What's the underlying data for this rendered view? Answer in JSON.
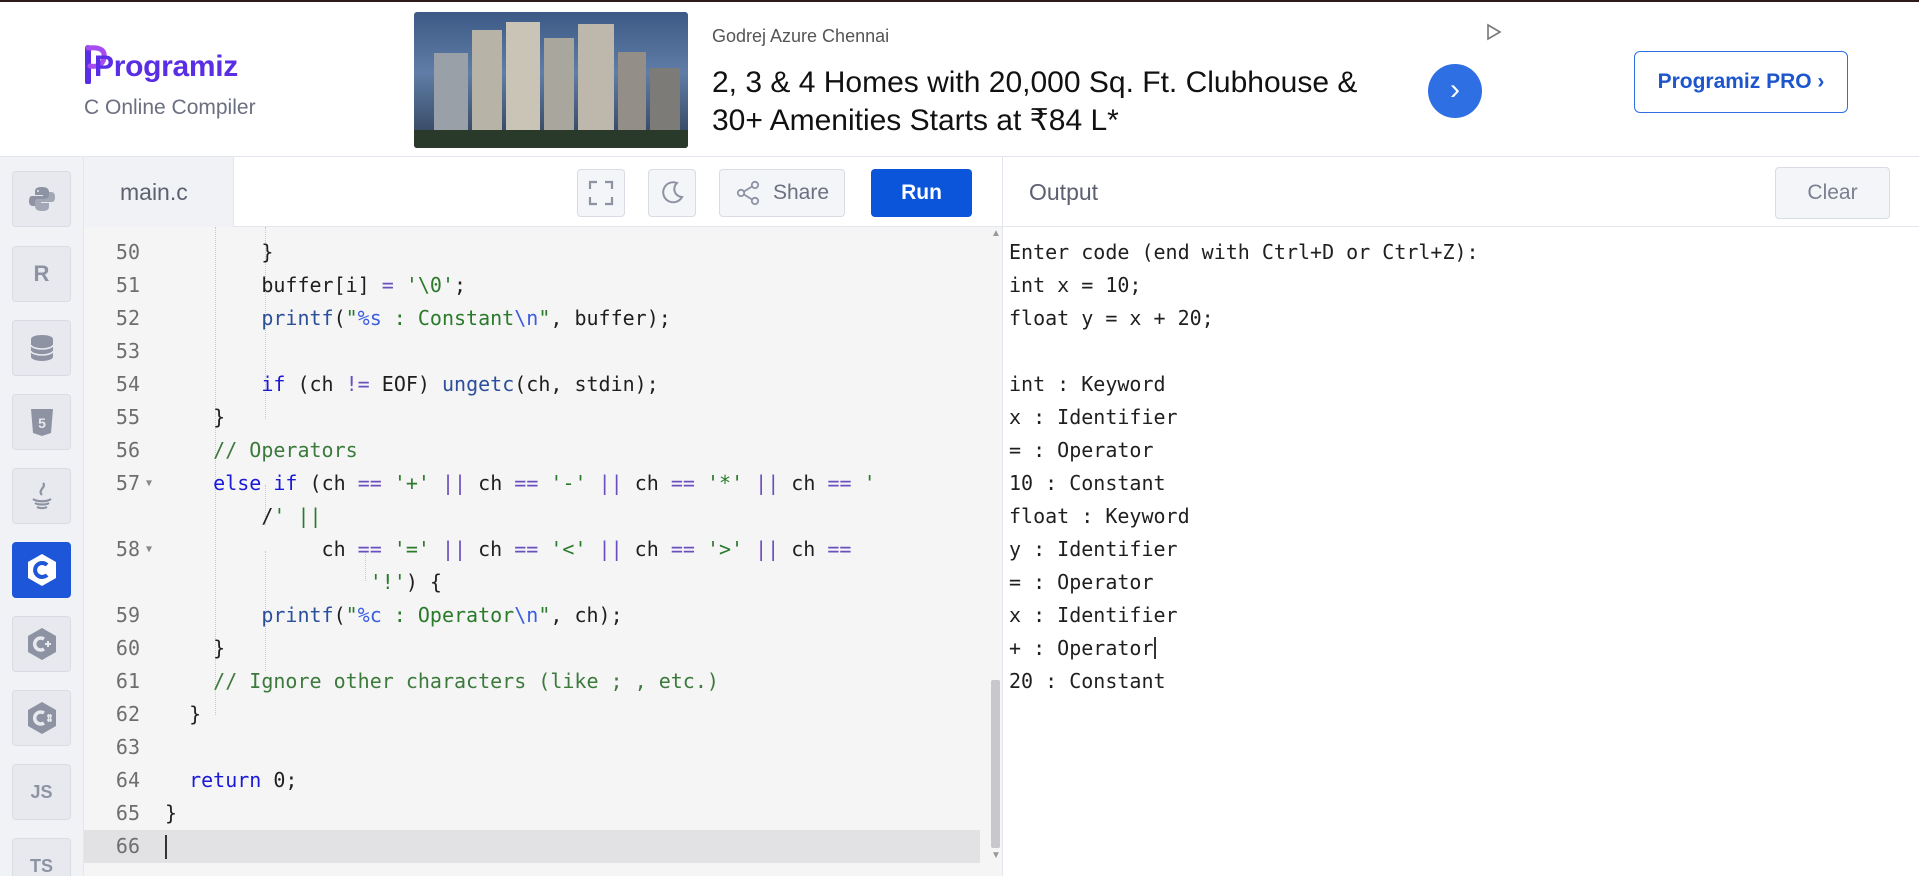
{
  "header": {
    "logo": "Programiz",
    "subtitle": "C Online Compiler",
    "pro_button": "Programiz PRO ›"
  },
  "ad": {
    "advertiser": "Godrej Azure Chennai",
    "headline": "2, 3 & 4 Homes with 20,000 Sq. Ft. Clubhouse & 30+ Amenities Starts at ₹84 L*",
    "arrow": "›"
  },
  "rail": {
    "items": [
      {
        "name": "python",
        "label": ""
      },
      {
        "name": "r",
        "label": "R"
      },
      {
        "name": "sql",
        "label": ""
      },
      {
        "name": "html",
        "label": "5"
      },
      {
        "name": "java",
        "label": ""
      },
      {
        "name": "c",
        "label": "C"
      },
      {
        "name": "cpp",
        "label": "C+"
      },
      {
        "name": "csharp",
        "label": "C#"
      },
      {
        "name": "javascript",
        "label": "JS"
      },
      {
        "name": "typescript",
        "label": "TS"
      }
    ],
    "active": "c"
  },
  "toolbar": {
    "file_name": "main.c",
    "share_label": "Share",
    "run_label": "Run"
  },
  "editor": {
    "line_numbers": [
      "50",
      "51",
      "52",
      "53",
      "54",
      "55",
      "56",
      "57",
      "",
      "58",
      "",
      "59",
      "60",
      "61",
      "62",
      "63",
      "64",
      "65",
      "66"
    ],
    "lines": [
      "        }",
      "        buffer[i] = '\\0';",
      "        printf(\"%s : Constant\\n\", buffer);",
      "",
      "        if (ch != EOF) ungetc(ch, stdin);",
      "    }",
      "    // Operators",
      "    else if (ch == '+' || ch == '-' || ch == '*' || ch == '",
      "        /' ||",
      "             ch == '=' || ch == '<' || ch == '>' || ch ==",
      "                 '!') {",
      "        printf(\"%c : Operator\\n\", ch);",
      "    }",
      "    // Ignore other characters (like ; , etc.)",
      "  }",
      "",
      "  return 0;",
      "}",
      ""
    ]
  },
  "output": {
    "title": "Output",
    "clear_label": "Clear",
    "lines": [
      "Enter code (end with Ctrl+D or Ctrl+Z):",
      "int x = 10;",
      "float y = x + 20;",
      "",
      "int : Keyword",
      "x : Identifier",
      "= : Operator",
      "10 : Constant",
      "float : Keyword",
      "y : Identifier",
      "= : Operator",
      "x : Identifier",
      "+ : Operator",
      "20 : Constant"
    ]
  },
  "colors": {
    "brand": "#5a2ee4",
    "accent": "#0a55d9",
    "keyword": "#1a1ad6",
    "string": "#2a7a2a",
    "comment": "#3c7a3c"
  }
}
